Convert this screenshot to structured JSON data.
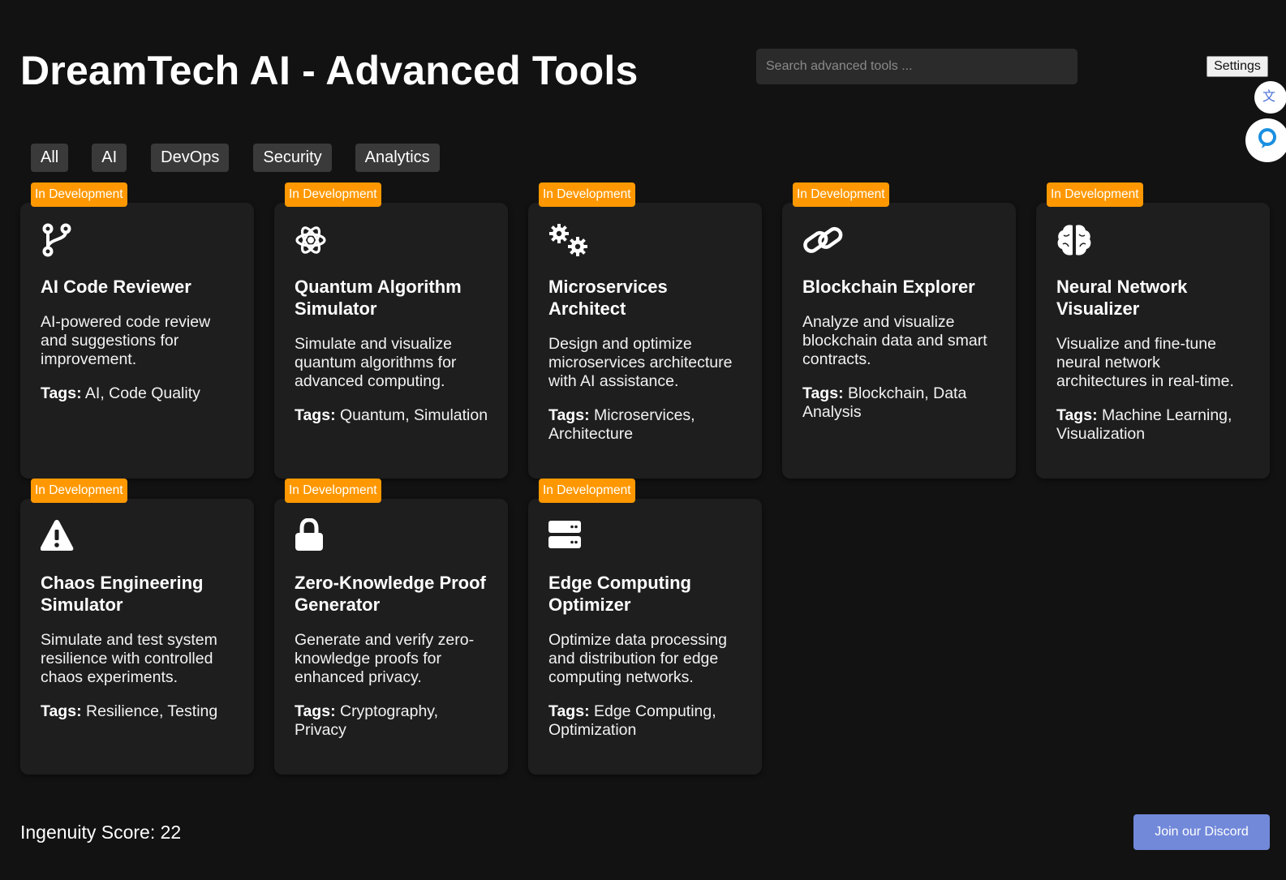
{
  "header": {
    "title": "DreamTech AI - Advanced Tools",
    "search_placeholder": "Search advanced tools ...",
    "settings_label": "Settings"
  },
  "filters": [
    "All",
    "AI",
    "DevOps",
    "Security",
    "Analytics"
  ],
  "tags_label": "Tags:",
  "cards": [
    {
      "badge": "In Development",
      "icon": "code-branch-icon",
      "title": "AI Code Reviewer",
      "description": "AI-powered code review and suggestions for improvement.",
      "tags": "AI, Code Quality"
    },
    {
      "badge": "In Development",
      "icon": "atom-icon",
      "title": "Quantum Algorithm Simulator",
      "description": "Simulate and visualize quantum algorithms for advanced computing.",
      "tags": "Quantum, Simulation"
    },
    {
      "badge": "In Development",
      "icon": "cogs-icon",
      "title": "Microservices Architect",
      "description": "Design and optimize microservices architecture with AI assistance.",
      "tags": "Microservices, Architecture"
    },
    {
      "badge": "In Development",
      "icon": "link-icon",
      "title": "Blockchain Explorer",
      "description": "Analyze and visualize blockchain data and smart contracts.",
      "tags": "Blockchain, Data Analysis"
    },
    {
      "badge": "In Development",
      "icon": "brain-icon",
      "title": "Neural Network Visualizer",
      "description": "Visualize and fine-tune neural network architectures in real-time.",
      "tags": "Machine Learning, Visualization"
    },
    {
      "badge": "In Development",
      "icon": "warning-icon",
      "title": "Chaos Engineering Simulator",
      "description": "Simulate and test system resilience with controlled chaos experiments.",
      "tags": "Resilience, Testing"
    },
    {
      "badge": "In Development",
      "icon": "lock-icon",
      "title": "Zero-Knowledge Proof Generator",
      "description": "Generate and verify zero-knowledge proofs for enhanced privacy.",
      "tags": "Cryptography, Privacy"
    },
    {
      "badge": "In Development",
      "icon": "server-icon",
      "title": "Edge Computing Optimizer",
      "description": "Optimize data processing and distribution for edge computing networks.",
      "tags": "Edge Computing, Optimization"
    }
  ],
  "footer": {
    "score_label": "Ingenuity Score: 22",
    "discord_label": "Join our Discord"
  },
  "colors": {
    "background": "#121212",
    "card": "#1e1e1e",
    "badge": "#ff9800",
    "discord": "#7289da"
  }
}
